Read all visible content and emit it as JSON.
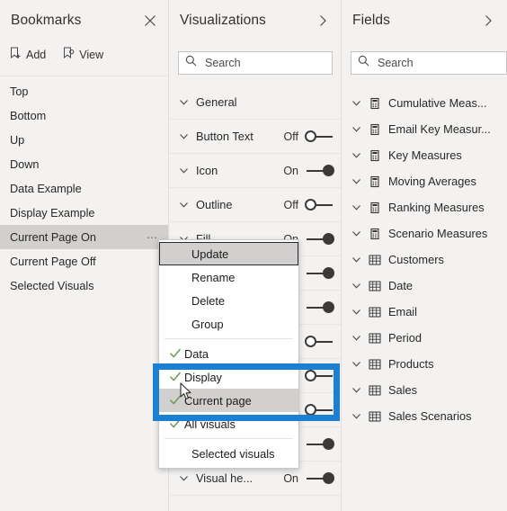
{
  "bookmarks": {
    "title": "Bookmarks",
    "close_icon": "close-icon",
    "toolbar": [
      {
        "label": "Add",
        "icon": "add-bookmark-icon"
      },
      {
        "label": "View",
        "icon": "view-bookmark-icon"
      }
    ],
    "items": [
      {
        "label": "Top",
        "selected": false
      },
      {
        "label": "Bottom",
        "selected": false
      },
      {
        "label": "Up",
        "selected": false
      },
      {
        "label": "Down",
        "selected": false
      },
      {
        "label": "Data Example",
        "selected": false
      },
      {
        "label": "Display Example",
        "selected": false
      },
      {
        "label": "Current Page On",
        "selected": true,
        "ellipsis": "⋯"
      },
      {
        "label": "Current Page Off",
        "selected": false
      },
      {
        "label": "Selected Visuals",
        "selected": false
      }
    ]
  },
  "visualizations": {
    "title": "Visualizations",
    "expand_icon": "chevron-right-icon",
    "search": {
      "placeholder": "Search",
      "value": "",
      "icon": "search-icon"
    },
    "cards": [
      {
        "label": "General",
        "toggle": null
      },
      {
        "label": "Button Text",
        "toggle": "Off"
      },
      {
        "label": "Icon",
        "toggle": "On"
      },
      {
        "label": "Outline",
        "toggle": "Off"
      },
      {
        "label": "Fill",
        "toggle": "On"
      },
      {
        "label": "",
        "toggle": "On"
      },
      {
        "label": "",
        "toggle": "On"
      },
      {
        "label": "",
        "toggle": "Off"
      },
      {
        "label": "",
        "toggle": "Off"
      },
      {
        "label": "",
        "toggle": "Off"
      },
      {
        "label": "",
        "toggle": "On"
      },
      {
        "label": "Visual he...",
        "toggle": "On"
      }
    ]
  },
  "fields": {
    "title": "Fields",
    "expand_icon": "chevron-right-icon",
    "search": {
      "placeholder": "Search",
      "value": "",
      "icon": "search-icon"
    },
    "items": [
      {
        "label": "Cumulative Meas...",
        "icon": "measure-table-icon"
      },
      {
        "label": "Email Key Measur...",
        "icon": "measure-table-icon"
      },
      {
        "label": "Key Measures",
        "icon": "measure-table-icon"
      },
      {
        "label": "Moving Averages",
        "icon": "measure-table-icon"
      },
      {
        "label": "Ranking Measures",
        "icon": "measure-table-icon"
      },
      {
        "label": "Scenario Measures",
        "icon": "measure-table-icon"
      },
      {
        "label": "Customers",
        "icon": "table-icon"
      },
      {
        "label": "Date",
        "icon": "table-icon"
      },
      {
        "label": "Email",
        "icon": "table-icon"
      },
      {
        "label": "Period",
        "icon": "table-icon"
      },
      {
        "label": "Products",
        "icon": "table-icon"
      },
      {
        "label": "Sales",
        "icon": "table-icon"
      },
      {
        "label": "Sales Scenarios",
        "icon": "table-icon"
      }
    ]
  },
  "context_menu": {
    "items": [
      {
        "label": "Update",
        "checked": false,
        "state": "focused",
        "separator_after": false
      },
      {
        "label": "Rename",
        "checked": false,
        "state": "",
        "separator_after": false
      },
      {
        "label": "Delete",
        "checked": false,
        "state": "",
        "separator_after": false
      },
      {
        "label": "Group",
        "checked": false,
        "state": "",
        "separator_after": true
      },
      {
        "label": "Data",
        "checked": true,
        "state": "",
        "separator_after": false
      },
      {
        "label": "Display",
        "checked": true,
        "state": "",
        "separator_after": false
      },
      {
        "label": "Current page",
        "checked": true,
        "state": "hovered",
        "separator_after": false
      },
      {
        "label": "All visuals",
        "checked": true,
        "state": "",
        "separator_after": true
      },
      {
        "label": "Selected visuals",
        "checked": false,
        "state": "",
        "separator_after": false
      }
    ]
  },
  "annotation": {
    "highlight_color": "#1d7fd0",
    "cursor": "mouse-pointer"
  }
}
